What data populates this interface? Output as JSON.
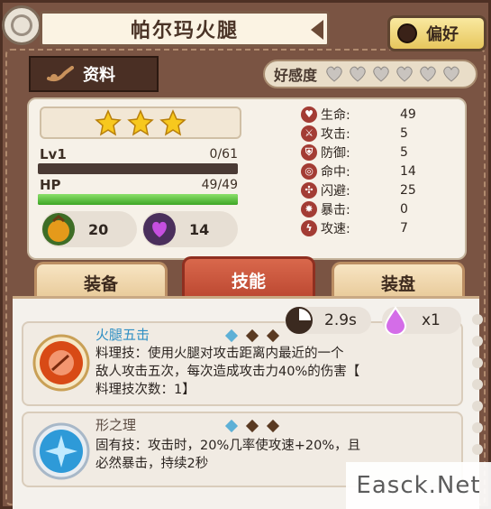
{
  "header": {
    "title": "帕尔玛火腿",
    "pref_label": "偏好"
  },
  "info_tab": {
    "label": "资料"
  },
  "affection": {
    "label": "好感度",
    "hearts_total": 6,
    "hearts_filled": 0
  },
  "character": {
    "stars": 3,
    "level_label": "Lv1",
    "exp_text": "0/61",
    "exp_fraction": 0,
    "hp_label": "HP",
    "hp_text": "49/49",
    "hp_fraction": 1,
    "resource_1": "20",
    "resource_2": "14"
  },
  "stats": [
    {
      "name": "生命:",
      "value": "49",
      "icon": "heart-icon"
    },
    {
      "name": "攻击:",
      "value": "5",
      "icon": "sword-icon"
    },
    {
      "name": "防御:",
      "value": "5",
      "icon": "shield-icon"
    },
    {
      "name": "命中:",
      "value": "14",
      "icon": "target-icon"
    },
    {
      "name": "闪避:",
      "value": "25",
      "icon": "dodge-icon"
    },
    {
      "name": "暴击:",
      "value": "0",
      "icon": "crit-icon"
    },
    {
      "name": "攻速:",
      "value": "7",
      "icon": "lightning-icon"
    }
  ],
  "tabs": [
    {
      "label": "装备",
      "active": false
    },
    {
      "label": "技能",
      "active": true
    },
    {
      "label": "装盘",
      "active": false
    }
  ],
  "skills": [
    {
      "name": "火腿五击",
      "cooldown": "2.9s",
      "energy": "x1",
      "desc_line1": "料理技：使用火腿对攻击距离内最近的一个",
      "desc_line2": "敌人攻击五次，每次造成攻击力40%的伤害【",
      "desc_line3": "料理技次数：1】",
      "name_color": "#2f8fc4"
    },
    {
      "name": "形之理",
      "desc_line1": "固有技：攻击时，20%几率使攻速+20%，且",
      "desc_line2": "必然暴击，持续2秒",
      "name_color": "#5a4a40"
    }
  ],
  "watermark": "Easck.Net",
  "colors": {
    "accent_red": "#b9452f",
    "hp_green": "#3da625",
    "bg_brown": "#7a5443"
  }
}
